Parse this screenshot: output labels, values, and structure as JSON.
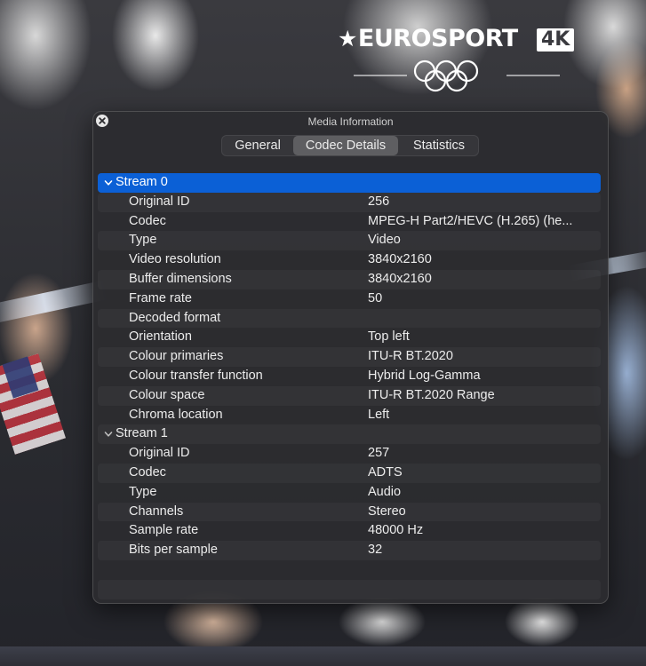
{
  "overlay": {
    "logo_text": "EUROSPORT",
    "logo_badge": "4K",
    "logo_star": "★"
  },
  "window": {
    "title": "Media Information",
    "tabs": [
      {
        "label": "General",
        "active": false
      },
      {
        "label": "Codec Details",
        "active": true
      },
      {
        "label": "Statistics",
        "active": false
      }
    ]
  },
  "streams": [
    {
      "label": "Stream 0",
      "expanded": true,
      "selected": true,
      "properties": [
        {
          "key": "Original ID",
          "value": "256"
        },
        {
          "key": "Codec",
          "value": "MPEG-H Part2/HEVC (H.265) (he..."
        },
        {
          "key": "Type",
          "value": "Video"
        },
        {
          "key": "Video resolution",
          "value": "3840x2160"
        },
        {
          "key": "Buffer dimensions",
          "value": "3840x2160"
        },
        {
          "key": "Frame rate",
          "value": "50"
        },
        {
          "key": "Decoded format",
          "value": ""
        },
        {
          "key": "Orientation",
          "value": "Top left"
        },
        {
          "key": "Colour primaries",
          "value": "ITU-R BT.2020"
        },
        {
          "key": "Colour transfer function",
          "value": "Hybrid Log-Gamma"
        },
        {
          "key": "Colour space",
          "value": "ITU-R BT.2020 Range"
        },
        {
          "key": "Chroma location",
          "value": "Left"
        }
      ]
    },
    {
      "label": "Stream 1",
      "expanded": true,
      "selected": false,
      "properties": [
        {
          "key": "Original ID",
          "value": "257"
        },
        {
          "key": "Codec",
          "value": "ADTS"
        },
        {
          "key": "Type",
          "value": "Audio"
        },
        {
          "key": "Channels",
          "value": "Stereo"
        },
        {
          "key": "Sample rate",
          "value": "48000 Hz"
        },
        {
          "key": "Bits per sample",
          "value": "32"
        }
      ]
    }
  ],
  "colors": {
    "selection": "#0b60d6",
    "window_bg": "#2c2c2f",
    "text": "#ececec"
  }
}
